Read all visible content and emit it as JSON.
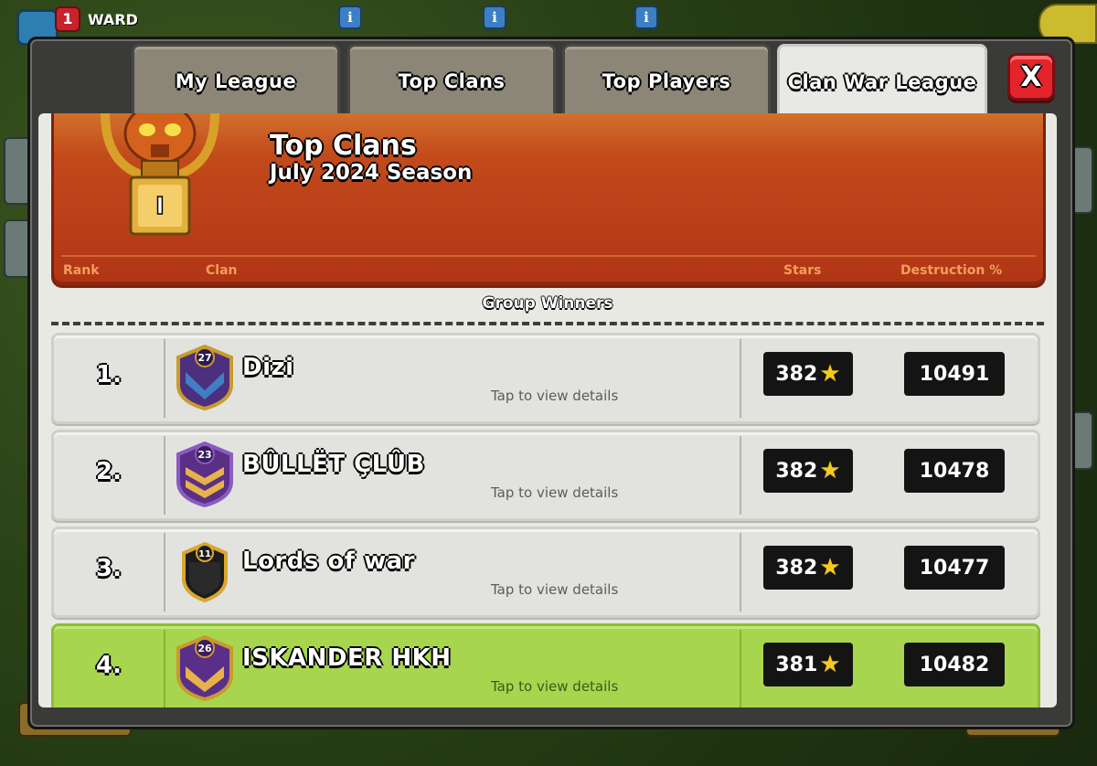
{
  "hud": {
    "level": "1",
    "player_name": "WARD"
  },
  "tabs": [
    {
      "label": "My League",
      "active": false
    },
    {
      "label": "Top Clans",
      "active": false
    },
    {
      "label": "Top Players",
      "active": false
    },
    {
      "label": "Clan War League",
      "active": true
    }
  ],
  "close_label": "X",
  "banner": {
    "title": "Top Clans",
    "season": "July 2024 Season",
    "trophy_tier": "I",
    "columns": {
      "rank": "Rank",
      "clan": "Clan",
      "stars": "Stars",
      "destruction": "Destruction %"
    }
  },
  "group_label": "Group Winners",
  "rows": [
    {
      "rank": "1.",
      "badge_level": "27",
      "name": "Dizi",
      "tap": "Tap to view details",
      "stars": "382",
      "destruction": "10491",
      "highlight": false
    },
    {
      "rank": "2.",
      "badge_level": "23",
      "name": "BÛLLËT ÇLÛB",
      "tap": "Tap to view details",
      "stars": "382",
      "destruction": "10478",
      "highlight": false
    },
    {
      "rank": "3.",
      "badge_level": "11",
      "name": "Lords of war",
      "tap": "Tap to view details",
      "stars": "382",
      "destruction": "10477",
      "highlight": false
    },
    {
      "rank": "4.",
      "badge_level": "26",
      "name": "ISKANDER HKH",
      "tap": "Tap to view details",
      "stars": "381",
      "destruction": "10482",
      "highlight": true
    }
  ],
  "colors": {
    "banner": "#c24a1b",
    "highlight_row": "#a7d64e",
    "close": "#e3242b",
    "star": "#f4cb1c"
  }
}
